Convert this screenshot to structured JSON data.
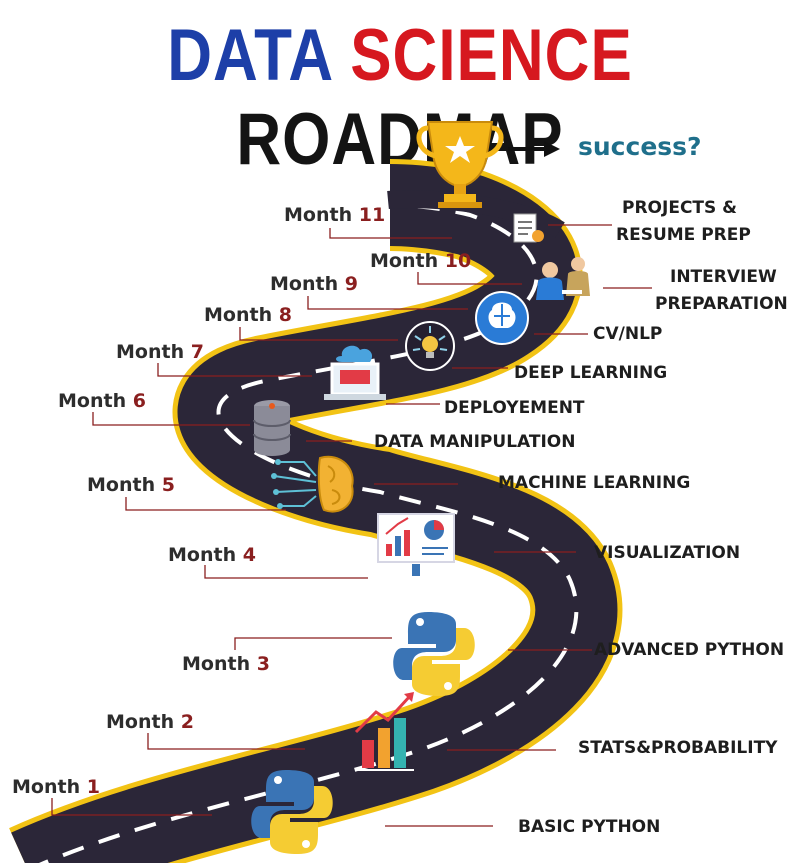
{
  "title": {
    "word1": "DATA",
    "word2": "SCIENCE",
    "word3": "ROADMAP",
    "colors": {
      "word1": "#1d3fa8",
      "word2": "#d6181f",
      "word3": "#141414"
    }
  },
  "goal": {
    "text": "success?",
    "icon": "trophy-icon"
  },
  "colors": {
    "road": "#2b2638",
    "road_edge": "#f2c315",
    "lane": "#ffffff",
    "leader": "#8a1f1f"
  },
  "months": [
    {
      "word": "Month",
      "num": "1"
    },
    {
      "word": "Month",
      "num": "2"
    },
    {
      "word": "Month",
      "num": "3"
    },
    {
      "word": "Month",
      "num": "4"
    },
    {
      "word": "Month",
      "num": "5"
    },
    {
      "word": "Month",
      "num": "6"
    },
    {
      "word": "Month",
      "num": "7"
    },
    {
      "word": "Month",
      "num": "8"
    },
    {
      "word": "Month",
      "num": "9"
    },
    {
      "word": "Month",
      "num": "10"
    },
    {
      "word": "Month",
      "num": "11"
    }
  ],
  "topics": [
    {
      "line1": "BASIC PYTHON"
    },
    {
      "line1": "STATS&PROBABILITY"
    },
    {
      "line1": "ADVANCED PYTHON"
    },
    {
      "line1": "VISUALIZATION"
    },
    {
      "line1": "MACHINE LEARNING"
    },
    {
      "line1": "DATA MANIPULATION"
    },
    {
      "line1": "DEPLOYEMENT"
    },
    {
      "line1": "DEEP LEARNING"
    },
    {
      "line1": "CV/NLP"
    },
    {
      "line1": "INTERVIEW",
      "line2": "PREPARATION"
    },
    {
      "line1": "PROJECTS &",
      "line2": "RESUME PREP"
    }
  ],
  "icons": [
    "python-logo-icon",
    "bar-chart-icon",
    "python-logo-icon",
    "dashboard-icon",
    "brain-circuit-icon",
    "database-icon",
    "laptop-cloud-icon",
    "lightbulb-icon",
    "brain-head-icon",
    "interview-icon",
    "resume-icon"
  ]
}
